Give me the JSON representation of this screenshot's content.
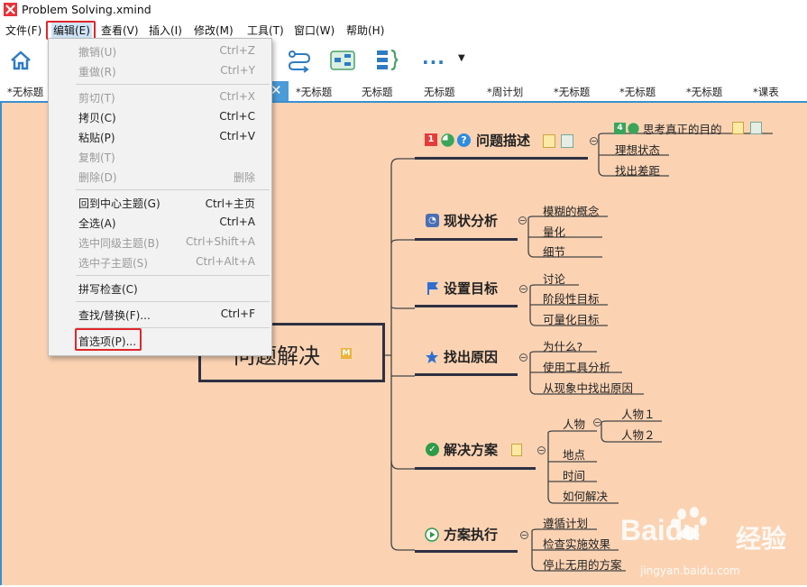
{
  "window": {
    "title": "Problem Solving.xmind"
  },
  "menubar": {
    "items": [
      "文件(F)",
      "编辑(E)",
      "查看(V)",
      "插入(I)",
      "修改(M)",
      "工具(T)",
      "窗口(W)",
      "帮助(H)"
    ]
  },
  "edit_menu": {
    "items": [
      {
        "label": "撤销(U)",
        "shortcut": "Ctrl+Z",
        "enabled": false
      },
      {
        "label": "重做(R)",
        "shortcut": "Ctrl+Y",
        "enabled": false
      },
      {
        "label": "剪切(T)",
        "shortcut": "Ctrl+X",
        "enabled": false
      },
      {
        "label": "拷贝(C)",
        "shortcut": "Ctrl+C",
        "enabled": true
      },
      {
        "label": "粘贴(P)",
        "shortcut": "Ctrl+V",
        "enabled": true
      },
      {
        "label": "复制(T)",
        "shortcut": "",
        "enabled": false
      },
      {
        "label": "删除(D)",
        "shortcut": "删除",
        "enabled": false
      },
      {
        "label": "回到中心主题(G)",
        "shortcut": "Ctrl+主页",
        "enabled": true
      },
      {
        "label": "全选(A)",
        "shortcut": "Ctrl+A",
        "enabled": true
      },
      {
        "label": "选中同级主题(B)",
        "shortcut": "Ctrl+Shift+A",
        "enabled": false
      },
      {
        "label": "选中子主题(S)",
        "shortcut": "Ctrl+Alt+A",
        "enabled": false
      },
      {
        "label": "拼写检查(C)",
        "shortcut": "",
        "enabled": true
      },
      {
        "label": "查找/替换(F)...",
        "shortcut": "Ctrl+F",
        "enabled": true
      },
      {
        "label": "首选项(P)...",
        "shortcut": "",
        "enabled": true
      }
    ]
  },
  "toolbar": {
    "more_label": "..."
  },
  "tabs": [
    "*无标题",
    "*无标题",
    "无标题",
    "无标题",
    "*周计划",
    "*无标题",
    "*无标题",
    "*无标题",
    "*课表"
  ],
  "map": {
    "central": "问题解决",
    "central_marker": "M",
    "branches": [
      {
        "label": "问题描述",
        "markers": [
          "1"
        ],
        "children": [
          "思考真正的目的",
          "理想状态",
          "找出差距"
        ],
        "child_marker": "4"
      },
      {
        "label": "现状分析",
        "children": [
          "模糊的概念",
          "量化",
          "细节"
        ]
      },
      {
        "label": "设置目标",
        "children": [
          "讨论",
          "阶段性目标",
          "可量化目标"
        ]
      },
      {
        "label": "找出原因",
        "children": [
          "为什么?",
          "使用工具分析",
          "从现象中找出原因"
        ]
      },
      {
        "label": "解决方案",
        "children": [
          "人物",
          "地点",
          "时间",
          "如何解决"
        ],
        "grandchildren": [
          "人物１",
          "人物２"
        ]
      },
      {
        "label": "方案执行",
        "children": [
          "遵循计划",
          "检查实施效果",
          "停止无用的方案"
        ]
      }
    ]
  },
  "watermark": {
    "brand": "Baidu",
    "cn": "经验",
    "url": "jingyan.baidu.com"
  },
  "colors": {
    "canvas": "#fbd3b3",
    "highlight": "#e0262a",
    "accent": "#3a8fd0"
  }
}
